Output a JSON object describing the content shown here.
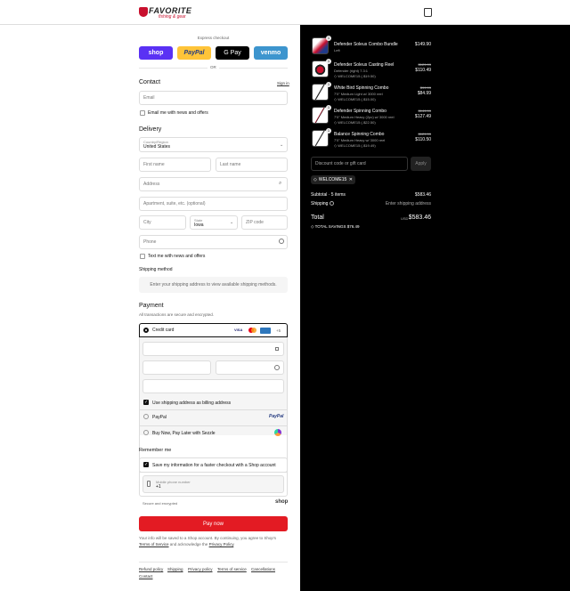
{
  "brand": {
    "name": "FAVORITE",
    "tagline": "fishing & gear"
  },
  "express": {
    "title": "Express checkout",
    "or": "OR",
    "shop": "shop",
    "paypal": "PayPal",
    "gpay": "G Pay",
    "venmo": "venmo"
  },
  "contact": {
    "title": "Contact",
    "sign_in": "Sign in",
    "email_placeholder": "Email",
    "news_label": "Email me with news and offers"
  },
  "delivery": {
    "title": "Delivery",
    "country_label": "Country/Region",
    "country_value": "United States",
    "first_name": "First name",
    "last_name": "Last name",
    "address": "Address",
    "apt": "Apartment, suite, etc. (optional)",
    "city": "City",
    "state_label": "State",
    "state_value": "Iowa",
    "zip": "ZIP code",
    "phone": "Phone",
    "text_label": "Text me with news and offers"
  },
  "shipping": {
    "title": "Shipping method",
    "placeholder": "Enter your shipping address to view available shipping methods."
  },
  "payment": {
    "title": "Payment",
    "subtitle": "All transactions are secure and encrypted.",
    "credit_card": "Credit card",
    "more_cards": "+5",
    "billing_label": "Use shipping address as billing address",
    "paypal": "PayPal",
    "paypal_logo": "PayPal",
    "sezzle": "Buy Now, Pay Later with Sezzle"
  },
  "remember": {
    "title": "Remember me",
    "save_label": "Save my information for a faster checkout with a Shop account",
    "phone_label": "Mobile phone number",
    "phone_value": "+1",
    "secure": "Secure and encrypted",
    "shop": "shop"
  },
  "pay_now": "Pay now",
  "legal": {
    "text1": "Your info will be saved to a Shop account. By continuing, you agree to Shop's",
    "terms": "Terms of Service",
    "and": "and acknowledge the",
    "privacy": "Privacy Policy",
    "end": "."
  },
  "footer": [
    "Refund policy",
    "Shipping",
    "Privacy policy",
    "Terms of service",
    "Cancellations",
    "Contact"
  ],
  "items": [
    {
      "qty": "1",
      "name": "Defender Soleus Combo Bundle",
      "sub": "Left",
      "discount": "",
      "old": "",
      "price": "$149.90"
    },
    {
      "qty": "1",
      "name": "Defender Soleus Casting Reel",
      "sub": "Defender (right) 7.3:1",
      "discount": "WELCOME15 (-$19.50)",
      "old": "$129.99",
      "price": "$110.49"
    },
    {
      "qty": "1",
      "name": "White Bird Spinning Combo",
      "sub": "7'0\" Medium Light w/ 3000 reel",
      "discount": "WELCOME15 (-$15.00)",
      "old": "$99.99",
      "price": "$84.99"
    },
    {
      "qty": "1",
      "name": "Defender Spinning Combo",
      "sub": "7'0\" Medium Heavy (2pc) w/ 3000 reel",
      "discount": "WELCOME15 (-$22.50)",
      "old": "$149.99",
      "price": "$127.49"
    },
    {
      "qty": "1",
      "name": "Balance Spinning Combo",
      "sub": "7'0\" Medium Heavy w/ 3000 reel",
      "discount": "WELCOME15 (-$19.49)",
      "old": "$129.99",
      "price": "$110.50"
    }
  ],
  "summary": {
    "discount_placeholder": "Discount code or gift card",
    "apply": "Apply",
    "code": "WELCOME15",
    "subtotal_label": "Subtotal · 5 items",
    "subtotal": "$583.46",
    "shipping_label": "Shipping",
    "shipping_value": "Enter shipping address",
    "total_label": "Total",
    "currency": "USD",
    "total": "$583.46",
    "savings": "TOTAL SAVINGS $76.49"
  },
  "colors": {
    "shop": "#5a31f4",
    "paypal": "#ffc439",
    "gpay": "#000000",
    "venmo": "#3d95ce",
    "pay_now": "#e31b23"
  }
}
